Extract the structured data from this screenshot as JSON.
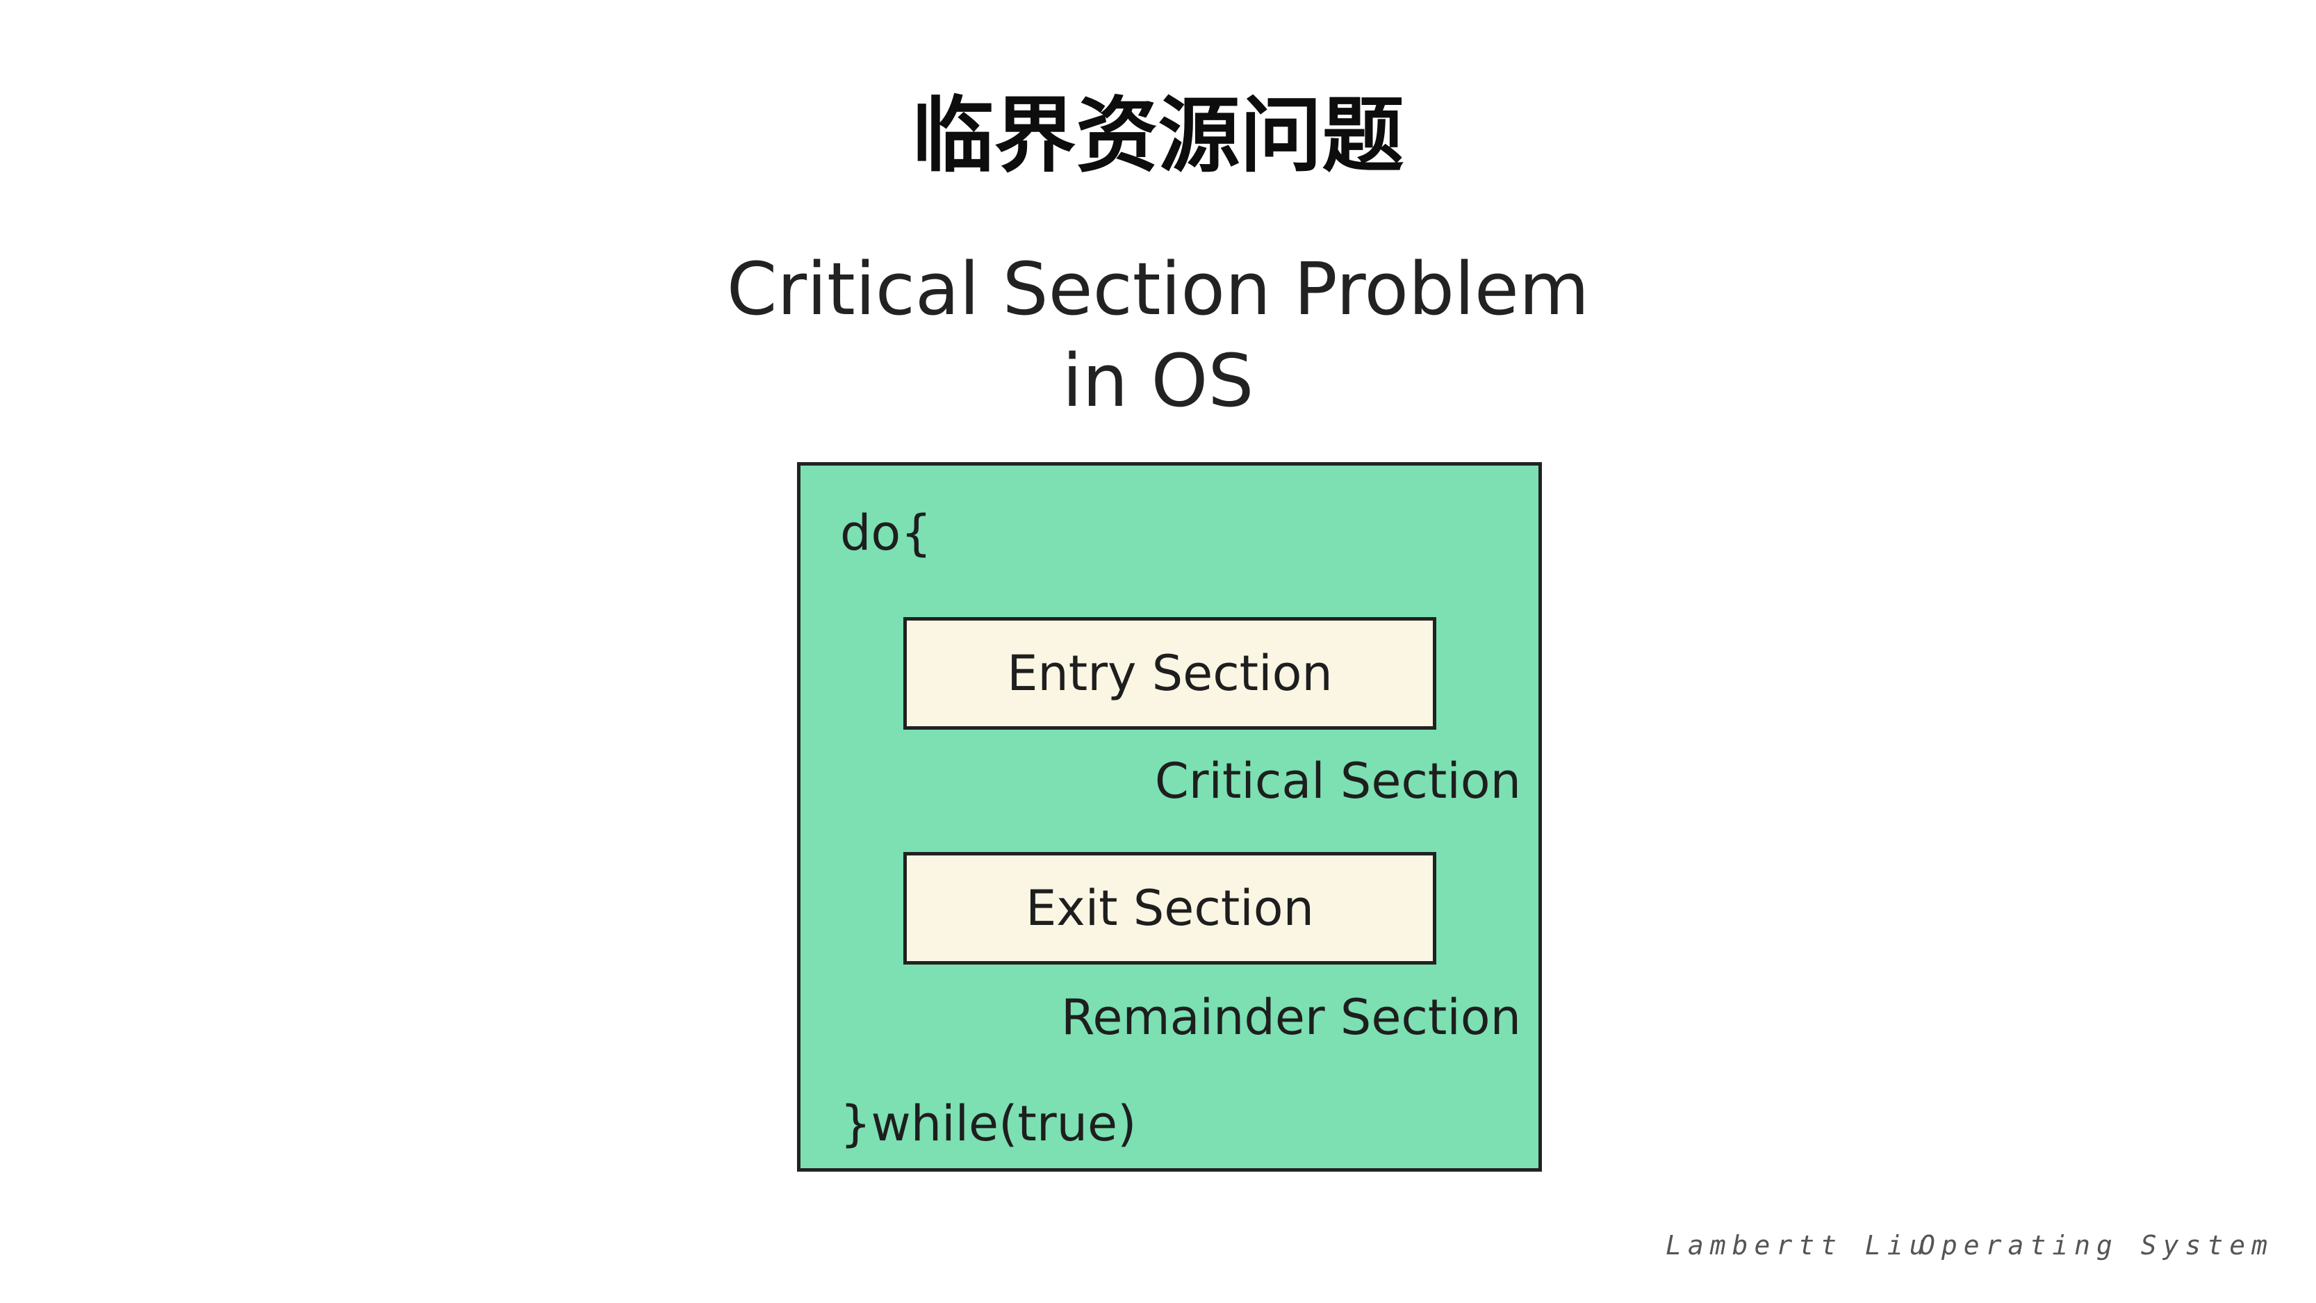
{
  "slide": {
    "title": "临界资源问题"
  },
  "figure": {
    "title_line1": "Critical Section Problem",
    "title_line2": "in OS",
    "code_start": "do{",
    "entry_section": "Entry Section",
    "critical_section": "Critical Section",
    "exit_section": "Exit Section",
    "remainder_section": "Remainder Section",
    "code_end": "}while(true)",
    "colors": {
      "outer_box_fill": "#7ce0b2",
      "inner_box_fill": "#fbf6e4",
      "border": "#222222"
    }
  },
  "footer": {
    "author": "Lambertt Liu",
    "course": "Operating System"
  }
}
